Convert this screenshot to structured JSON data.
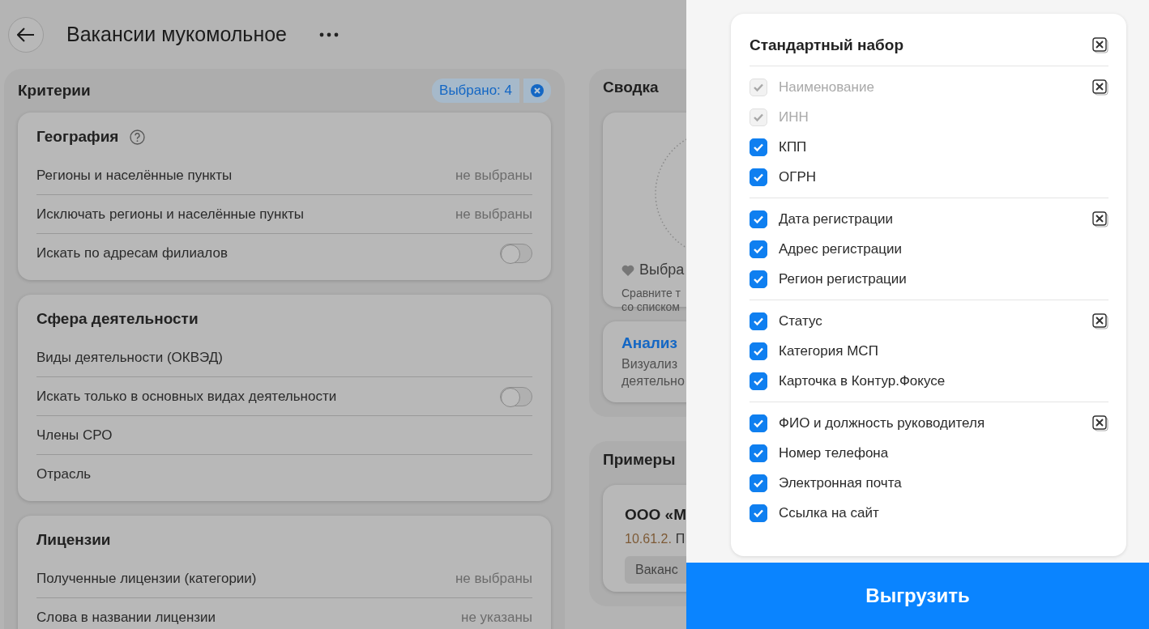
{
  "header": {
    "title": "Вакансии мукомольное"
  },
  "criteria": {
    "title": "Критерии",
    "selected_badge": "Выбрано: 4",
    "sections": [
      {
        "title": "География",
        "help": true,
        "rows": [
          {
            "kind": "value",
            "label": "Регионы и населённые пункты",
            "value": "не выбраны"
          },
          {
            "kind": "value",
            "label": "Исключать регионы и населённые пункты",
            "value": "не выбраны"
          },
          {
            "kind": "toggle",
            "label": "Искать по адресам филиалов",
            "on": false
          }
        ]
      },
      {
        "title": "Сфера деятельности",
        "help": false,
        "rows": [
          {
            "kind": "plain",
            "label": "Виды деятельности (ОКВЭД)"
          },
          {
            "kind": "toggle",
            "label": "Искать только в основных видах деятельности",
            "on": false
          },
          {
            "kind": "plain",
            "label": "Члены СРО"
          },
          {
            "kind": "plain",
            "label": "Отрасль"
          }
        ]
      },
      {
        "title": "Лицензии",
        "help": false,
        "rows": [
          {
            "kind": "value",
            "label": "Полученные лицензии (категории)",
            "value": "не выбраны"
          },
          {
            "kind": "value",
            "label": "Слова в названии лицензии",
            "value": "не указаны"
          }
        ]
      }
    ]
  },
  "summary": {
    "title": "Сводка",
    "favorites_label": "Выбра",
    "favorites_text": [
      "Сравните т",
      "со списком"
    ],
    "analysis_title": "Анализ",
    "analysis_text": [
      "Визуализ",
      "деятельно"
    ]
  },
  "examples": {
    "title": "Примеры",
    "company": "ООО «М",
    "okved_code": "10.61.2.",
    "okved_text": "П",
    "tag": "Ваканс"
  },
  "export_panel": {
    "title": "Стандартный набор",
    "groups": [
      {
        "items": [
          {
            "label": "Наименование",
            "checked": true,
            "disabled": true
          },
          {
            "label": "ИНН",
            "checked": true,
            "disabled": true
          },
          {
            "label": "КПП",
            "checked": true,
            "disabled": false
          },
          {
            "label": "ОГРН",
            "checked": true,
            "disabled": false
          }
        ]
      },
      {
        "items": [
          {
            "label": "Дата регистрации",
            "checked": true,
            "disabled": false
          },
          {
            "label": "Адрес регистрации",
            "checked": true,
            "disabled": false
          },
          {
            "label": "Регион регистрации",
            "checked": true,
            "disabled": false
          }
        ]
      },
      {
        "items": [
          {
            "label": "Статус",
            "checked": true,
            "disabled": false
          },
          {
            "label": "Категория МСП",
            "checked": true,
            "disabled": false
          },
          {
            "label": "Карточка в Контур.Фокусе",
            "checked": true,
            "disabled": false
          }
        ]
      },
      {
        "items": [
          {
            "label": "ФИО и должность руководителя",
            "checked": true,
            "disabled": false
          },
          {
            "label": "Номер телефона",
            "checked": true,
            "disabled": false
          },
          {
            "label": "Электронная почта",
            "checked": true,
            "disabled": false
          },
          {
            "label": "Ссылка на сайт",
            "checked": true,
            "disabled": false
          }
        ]
      }
    ],
    "button": "Выгрузить"
  }
}
